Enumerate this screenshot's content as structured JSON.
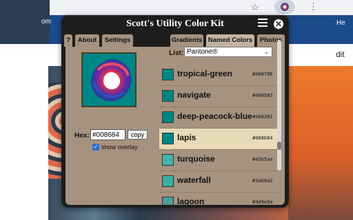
{
  "browser": {
    "page_snippets": {
      "left": "om",
      "right": "He",
      "body": "dit"
    },
    "icons": [
      "star-icon",
      "extension-icon",
      "menu-icon"
    ]
  },
  "popup": {
    "title": "Scott's Utility Color Kit",
    "tabs": [
      {
        "label": "?",
        "active": false
      },
      {
        "label": "About",
        "active": false
      },
      {
        "label": "Settings",
        "active": false
      },
      {
        "label": "Gradients",
        "active": false
      },
      {
        "label": "Named Colors",
        "active": true
      },
      {
        "label": "Photos",
        "active": false
      }
    ],
    "hex_label": "Hex:",
    "hex_value": "#008684",
    "copy_label": "copy",
    "overlay_label": "show overlay",
    "overlay_checked": true,
    "list_label": "List:",
    "list_selected": "Pantone®",
    "colors": [
      {
        "name": "tropical-green",
        "code": "#008786",
        "selected": false
      },
      {
        "name": "navigate",
        "code": "#008583",
        "selected": false
      },
      {
        "name": "deep-peacock-blue",
        "code": "#008381",
        "selected": false
      },
      {
        "name": "lapis",
        "code": "#008684",
        "selected": true
      },
      {
        "name": "turquoise",
        "code": "#45b5aa",
        "selected": false
      },
      {
        "name": "waterfall",
        "code": "#3ab0a2",
        "selected": false
      },
      {
        "name": "lagoon",
        "code": "#4d9e9a",
        "selected": false
      }
    ],
    "accent": "#a5937f",
    "selected_row_color": "#e8dcb8"
  }
}
